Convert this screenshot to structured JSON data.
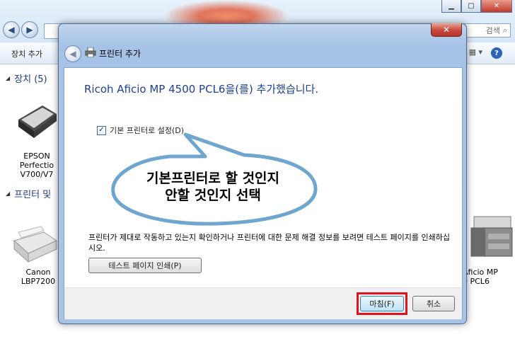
{
  "background": {
    "search_text": "검색",
    "toolbar_add_device": "장치 추가",
    "section_devices": "장치 (5)",
    "section_printers": "프린터 및",
    "epson_label": "EPSON\nPerfectio\nV700/V7",
    "canon_label": "Canon\nLBP7200",
    "ricoh_label": "Aficio MP\n0 PCL6"
  },
  "dialog": {
    "title": "프린터 추가",
    "heading": "Ricoh Aficio MP 4500 PCL6을(를) 추가했습니다.",
    "default_checkbox_label": "기본 프린터로 설정(D)",
    "default_checked": true,
    "info_text": "프린터가 제대로 작동하고 있는지 확인하거나 프린터에 대한 문제 해결 정보를 보려면 테스트 페이지를 인쇄하십시오.",
    "test_page_button": "테스트 페이지 인쇄(P)",
    "finish_button": "마침(F)",
    "cancel_button": "취소"
  },
  "callout": {
    "line1": "기본프린터로 할 것인지",
    "line2": "안할 것인지 선택"
  },
  "colors": {
    "heading": "#1a3e9a",
    "highlight": "#e0121b",
    "callout_border": "#6fa6cf"
  }
}
